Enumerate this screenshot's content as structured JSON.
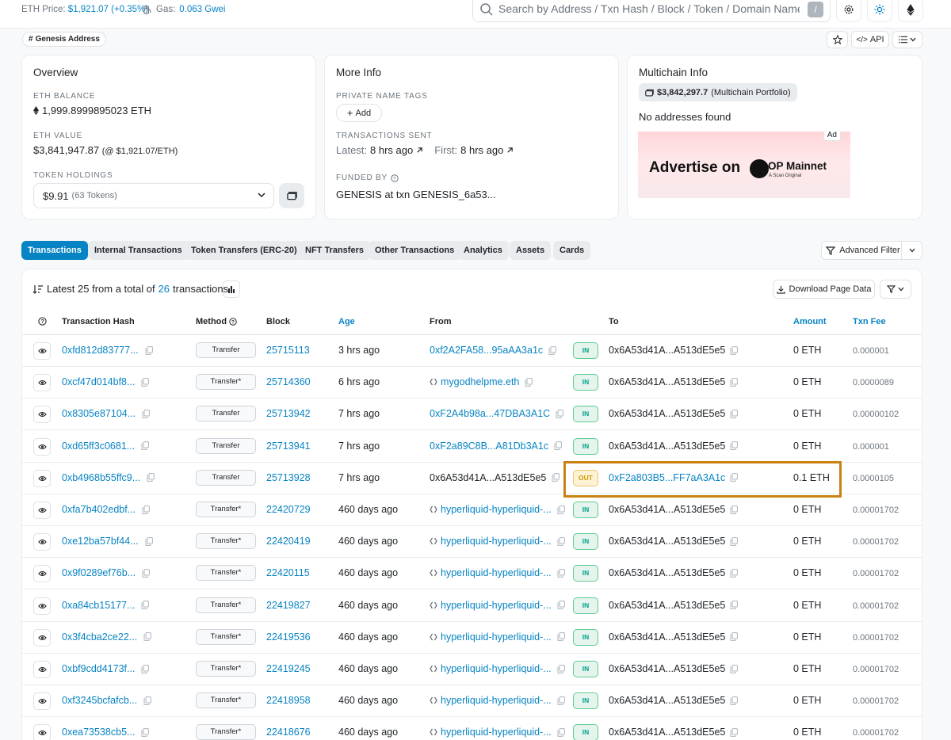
{
  "topbar": {
    "eth_price_label": "ETH Price:",
    "eth_price_value": "$1,921.07 (+0.35%)",
    "gas_label": "Gas:",
    "gas_value": "0.063 Gwei",
    "search_placeholder": "Search by Address / Txn Hash / Block / Token / Domain Name",
    "search_shortcut": "/"
  },
  "header": {
    "badge": "Genesis Address",
    "api_label": "API"
  },
  "overview": {
    "title": "Overview",
    "eth_balance_label": "ETH BALANCE",
    "eth_balance": "1,999.8999895023 ETH",
    "eth_value_label": "ETH VALUE",
    "eth_value": "$3,841,947.87",
    "eth_value_rate": "(@ $1,921.07/ETH)",
    "token_holdings_label": "TOKEN HOLDINGS",
    "token_holdings_value": "$9.91",
    "token_holdings_count": "(63 Tokens)"
  },
  "more_info": {
    "title": "More Info",
    "private_tags_label": "PRIVATE NAME TAGS",
    "add_label": "Add",
    "tx_sent_label": "TRANSACTIONS SENT",
    "latest_label": "Latest:",
    "latest_value": "8 hrs ago",
    "first_label": "First:",
    "first_value": "8 hrs ago",
    "funded_by_label": "FUNDED BY",
    "funded_by_value": "GENESIS at txn GENESIS_6a53..."
  },
  "multichain": {
    "title": "Multichain Info",
    "portfolio_value": "$3,842,297.7",
    "portfolio_label": "(Multichain Portfolio)",
    "no_addresses": "No addresses found",
    "ad_tag": "Ad",
    "ad_text": "Advertise on",
    "ad_brand": "OP Mainnet",
    "ad_brand_sub": "A Scan Original"
  },
  "tabs": [
    {
      "label": "Transactions",
      "active": true
    },
    {
      "label": "Internal Transactions"
    },
    {
      "label": "Token Transfers (ERC-20)"
    },
    {
      "label": "NFT Transfers"
    },
    {
      "label": "Other Transactions"
    },
    {
      "label": "Analytics"
    },
    {
      "label": "Assets"
    },
    {
      "label": "Cards"
    }
  ],
  "advanced_filter_label": "Advanced Filter",
  "table": {
    "summary_prefix": "Latest 25 from a total of",
    "summary_count": "26",
    "summary_suffix": "transactions",
    "download_label": "Download Page Data",
    "columns": {
      "hash": "Transaction Hash",
      "method": "Method",
      "block": "Block",
      "age": "Age",
      "from": "From",
      "to": "To",
      "amount": "Amount",
      "fee": "Txn Fee"
    },
    "rows": [
      {
        "hash": "0xfd812d83777...",
        "method": "Transfer",
        "block": "25715113",
        "age": "3 hrs ago",
        "from": "0xf2A2FA58...95aAA3a1c",
        "from_type": "link",
        "dir": "IN",
        "to": "0x6A53d41A...A513dE5e5",
        "to_type": "text",
        "amount": "0 ETH",
        "fee": "0.000001"
      },
      {
        "hash": "0xcf47d014bf8...",
        "method": "Transfer*",
        "block": "25714360",
        "age": "6 hrs ago",
        "from": "mygodhelpme.eth",
        "from_type": "ens",
        "dir": "IN",
        "to": "0x6A53d41A...A513dE5e5",
        "to_type": "text",
        "amount": "0 ETH",
        "fee": "0.0000089"
      },
      {
        "hash": "0x8305e87104...",
        "method": "Transfer",
        "block": "25713942",
        "age": "7 hrs ago",
        "from": "0xF2A4b98a...47DBA3A1C",
        "from_type": "link",
        "dir": "IN",
        "to": "0x6A53d41A...A513dE5e5",
        "to_type": "text",
        "amount": "0 ETH",
        "fee": "0.00000102"
      },
      {
        "hash": "0xd65ff3c0681...",
        "method": "Transfer",
        "block": "25713941",
        "age": "7 hrs ago",
        "from": "0xF2a89C8B...A81Db3A1c",
        "from_type": "link",
        "dir": "IN",
        "to": "0x6A53d41A...A513dE5e5",
        "to_type": "text",
        "amount": "0 ETH",
        "fee": "0.000001"
      },
      {
        "hash": "0xb4968b55ffc9...",
        "method": "Transfer",
        "block": "25713928",
        "age": "7 hrs ago",
        "from": "0x6A53d41A...A513dE5e5",
        "from_type": "text",
        "dir": "OUT",
        "to": "0xF2a803B5...FF7aA3A1c",
        "to_type": "link",
        "amount": "0.1 ETH",
        "fee": "0.0000105"
      },
      {
        "hash": "0xfa7b402edbf...",
        "method": "Transfer*",
        "block": "22420729",
        "age": "460 days ago",
        "from": "hyperliquid-hyperliquid-...",
        "from_type": "ens",
        "dir": "IN",
        "to": "0x6A53d41A...A513dE5e5",
        "to_type": "text",
        "amount": "0 ETH",
        "fee": "0.00001702"
      },
      {
        "hash": "0xe12ba57bf44...",
        "method": "Transfer*",
        "block": "22420419",
        "age": "460 days ago",
        "from": "hyperliquid-hyperliquid-...",
        "from_type": "ens",
        "dir": "IN",
        "to": "0x6A53d41A...A513dE5e5",
        "to_type": "text",
        "amount": "0 ETH",
        "fee": "0.00001702"
      },
      {
        "hash": "0x9f0289ef76b...",
        "method": "Transfer*",
        "block": "22420115",
        "age": "460 days ago",
        "from": "hyperliquid-hyperliquid-...",
        "from_type": "ens",
        "dir": "IN",
        "to": "0x6A53d41A...A513dE5e5",
        "to_type": "text",
        "amount": "0 ETH",
        "fee": "0.00001702"
      },
      {
        "hash": "0xa84cb15177...",
        "method": "Transfer*",
        "block": "22419827",
        "age": "460 days ago",
        "from": "hyperliquid-hyperliquid-...",
        "from_type": "ens",
        "dir": "IN",
        "to": "0x6A53d41A...A513dE5e5",
        "to_type": "text",
        "amount": "0 ETH",
        "fee": "0.00001702"
      },
      {
        "hash": "0x3f4cba2ce22...",
        "method": "Transfer*",
        "block": "22419536",
        "age": "460 days ago",
        "from": "hyperliquid-hyperliquid-...",
        "from_type": "ens",
        "dir": "IN",
        "to": "0x6A53d41A...A513dE5e5",
        "to_type": "text",
        "amount": "0 ETH",
        "fee": "0.00001702"
      },
      {
        "hash": "0xbf9cdd4173f...",
        "method": "Transfer*",
        "block": "22419245",
        "age": "460 days ago",
        "from": "hyperliquid-hyperliquid-...",
        "from_type": "ens",
        "dir": "IN",
        "to": "0x6A53d41A...A513dE5e5",
        "to_type": "text",
        "amount": "0 ETH",
        "fee": "0.00001702"
      },
      {
        "hash": "0xf3245bcfafcb...",
        "method": "Transfer*",
        "block": "22418958",
        "age": "460 days ago",
        "from": "hyperliquid-hyperliquid-...",
        "from_type": "ens",
        "dir": "IN",
        "to": "0x6A53d41A...A513dE5e5",
        "to_type": "text",
        "amount": "0 ETH",
        "fee": "0.00001702"
      },
      {
        "hash": "0xea73538cb5...",
        "method": "Transfer*",
        "block": "22418676",
        "age": "460 days ago",
        "from": "hyperliquid-hyperliquid-...",
        "from_type": "ens",
        "dir": "IN",
        "to": "0x6A53d41A...A513dE5e5",
        "to_type": "text",
        "amount": "0 ETH",
        "fee": "0.00001702"
      }
    ]
  },
  "colors": {
    "accent": "#0784c3",
    "highlight_box": "#c98213",
    "in_badge": "#00a186",
    "out_badge": "#cc9a06"
  }
}
